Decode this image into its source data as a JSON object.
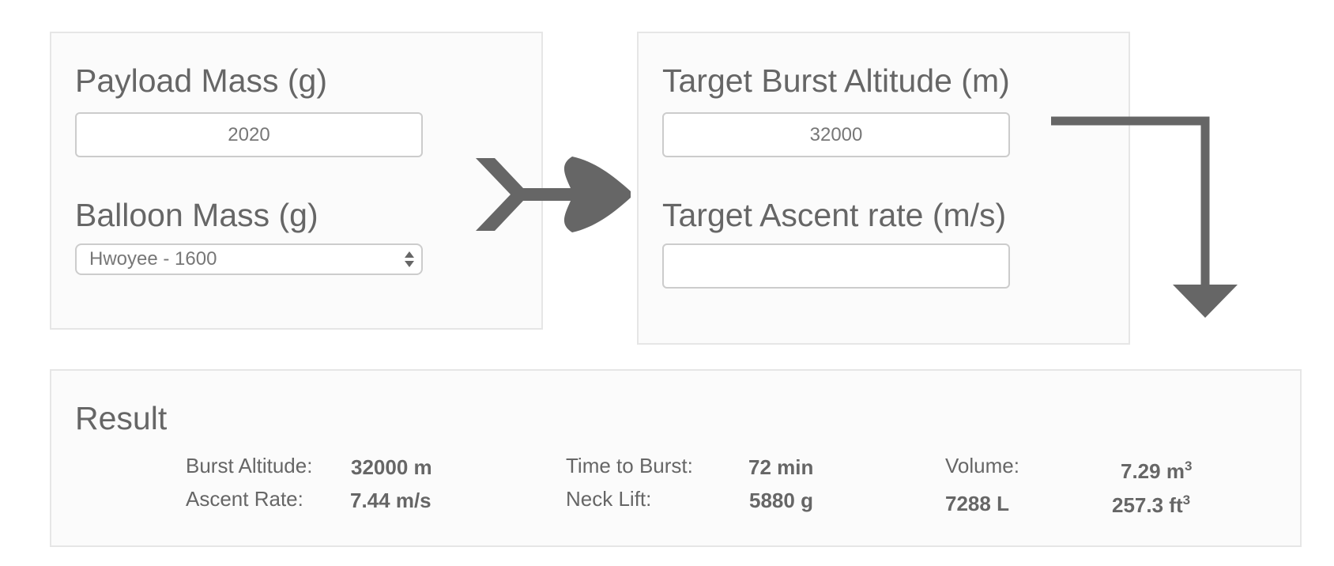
{
  "inputs": {
    "payload_mass": {
      "label": "Payload Mass (g)",
      "value": "2020"
    },
    "balloon_mass": {
      "label": "Balloon Mass (g)",
      "selected": "Hwoyee - 1600"
    },
    "target_burst_altitude": {
      "label": "Target Burst Altitude (m)",
      "value": "32000"
    },
    "target_ascent_rate": {
      "label": "Target Ascent rate (m/s)",
      "value": ""
    }
  },
  "result": {
    "title": "Result",
    "burst_altitude": {
      "label": "Burst Altitude:",
      "value": "32000 m"
    },
    "ascent_rate": {
      "label": "Ascent Rate:",
      "value": "7.44 m/s"
    },
    "time_to_burst": {
      "label": "Time to Burst:",
      "value": "72 min"
    },
    "neck_lift": {
      "label": "Neck Lift:",
      "value": "5880 g"
    },
    "volume": {
      "label": "Volume:",
      "cubic_meters": "7.29 m",
      "liters": "7288 L",
      "cubic_feet": "257.3 ft",
      "exponent": "3"
    }
  },
  "colors": {
    "arrow": "#666666",
    "panel_bg": "#fbfbfb",
    "panel_border": "#e6e6e6",
    "text": "#666666"
  },
  "icons": {
    "flow_arrow": "fletched-arrow-right-icon",
    "bend_arrow": "arrow-right-down-icon",
    "select_arrows": "select-updown-icon"
  }
}
